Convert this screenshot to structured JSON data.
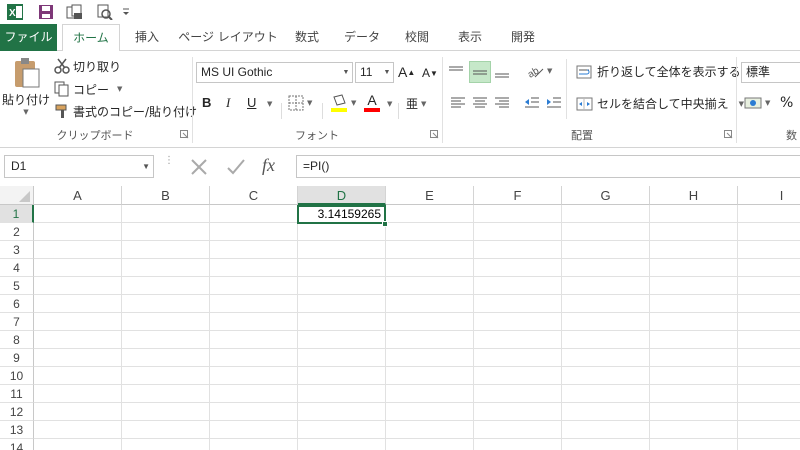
{
  "qat": {
    "icons": [
      "excel-logo-icon",
      "save-icon",
      "print-preview-icon",
      "print-icon",
      "customize-qat-icon"
    ]
  },
  "tabs": [
    {
      "label": "ファイル"
    },
    {
      "label": "ホーム"
    },
    {
      "label": "挿入"
    },
    {
      "label": "ページ レイアウト"
    },
    {
      "label": "数式"
    },
    {
      "label": "データ"
    },
    {
      "label": "校閲"
    },
    {
      "label": "表示"
    },
    {
      "label": "開発"
    }
  ],
  "ribbon": {
    "clipboard": {
      "paste_label": "貼り付け",
      "cut_label": "切り取り",
      "copy_label": "コピー",
      "format_painter_label": "書式のコピー/貼り付け",
      "group_label": "クリップボード"
    },
    "font": {
      "font_name": "MS UI Gothic",
      "font_size": "11",
      "grow_label": "A",
      "shrink_label": "A",
      "bold_label": "B",
      "italic_label": "I",
      "underline_label": "U",
      "font_color_label": "A",
      "group_label": "フォント",
      "accent_highlight": "#ffff00",
      "accent_font_color": "#ff0000"
    },
    "alignment": {
      "wrap_label": "折り返して全体を表示する",
      "merge_label": "セルを結合して中央揃え",
      "group_label": "配置"
    },
    "number": {
      "format": "標準",
      "percent_label": "%",
      "group_label_partial": "数"
    }
  },
  "formula_bar": {
    "name_box": "D1",
    "formula": "=PI()",
    "fx_label": "fx"
  },
  "grid": {
    "columns": [
      "A",
      "B",
      "C",
      "D",
      "E",
      "F",
      "G",
      "H",
      "I"
    ],
    "rows": [
      "1",
      "2",
      "3",
      "4",
      "5",
      "6",
      "7",
      "8",
      "9",
      "10",
      "11",
      "12",
      "13",
      "14"
    ],
    "selected_column": "D",
    "selected_row": "1",
    "cell_d1_value": "3.14159265"
  },
  "colors": {
    "accent": "#217346"
  }
}
